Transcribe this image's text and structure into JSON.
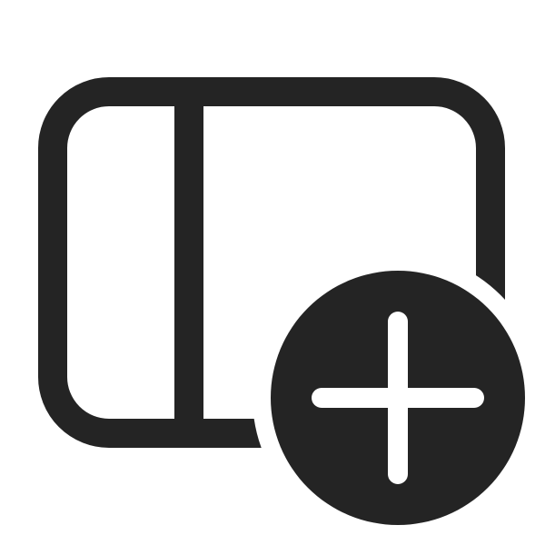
{
  "icon": {
    "name": "panel-left-add-icon",
    "colors": {
      "foreground": "#242424",
      "background": "#ffffff"
    }
  }
}
